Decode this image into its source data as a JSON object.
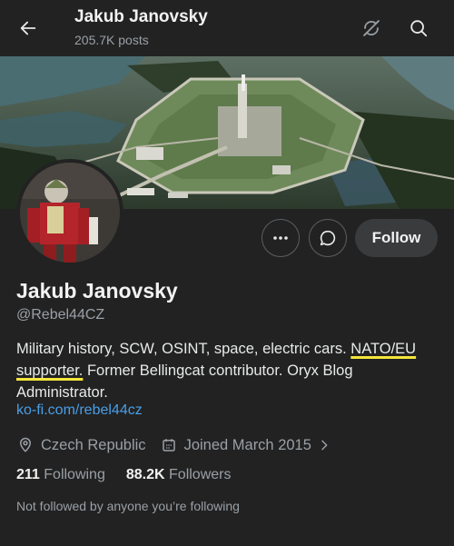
{
  "header": {
    "title": "Jakub Janovsky",
    "posts": "205.7K posts"
  },
  "icons": {
    "back": "arrow-left-icon",
    "unsubscribe": "notification-off-icon",
    "search": "search-icon",
    "more": "more-dots-icon",
    "message": "message-icon",
    "location": "location-pin-icon",
    "calendar": "calendar-icon",
    "chevron": "chevron-right-icon"
  },
  "actions": {
    "follow_label": "Follow"
  },
  "profile": {
    "name": "Jakub Janovsky",
    "handle": "@Rebel44CZ",
    "bio_part1": "Military history, SCW, OSINT, space, electric cars. ",
    "bio_highlight": "NATO/EU supporter.",
    "bio_part2": " Former Bellingcat contributor. Oryx Blog Administrator.",
    "link": "ko-fi.com/rebel44cz",
    "location": "Czech Republic",
    "joined": "Joined March 2015",
    "following_count": "211",
    "following_label": "Following",
    "followers_count": "88.2K",
    "followers_label": "Followers",
    "not_followed_text": "Not followed by anyone you’re following"
  },
  "colors": {
    "background": "#222222",
    "link": "#4a9fe8",
    "highlight": "#f3e63b"
  }
}
